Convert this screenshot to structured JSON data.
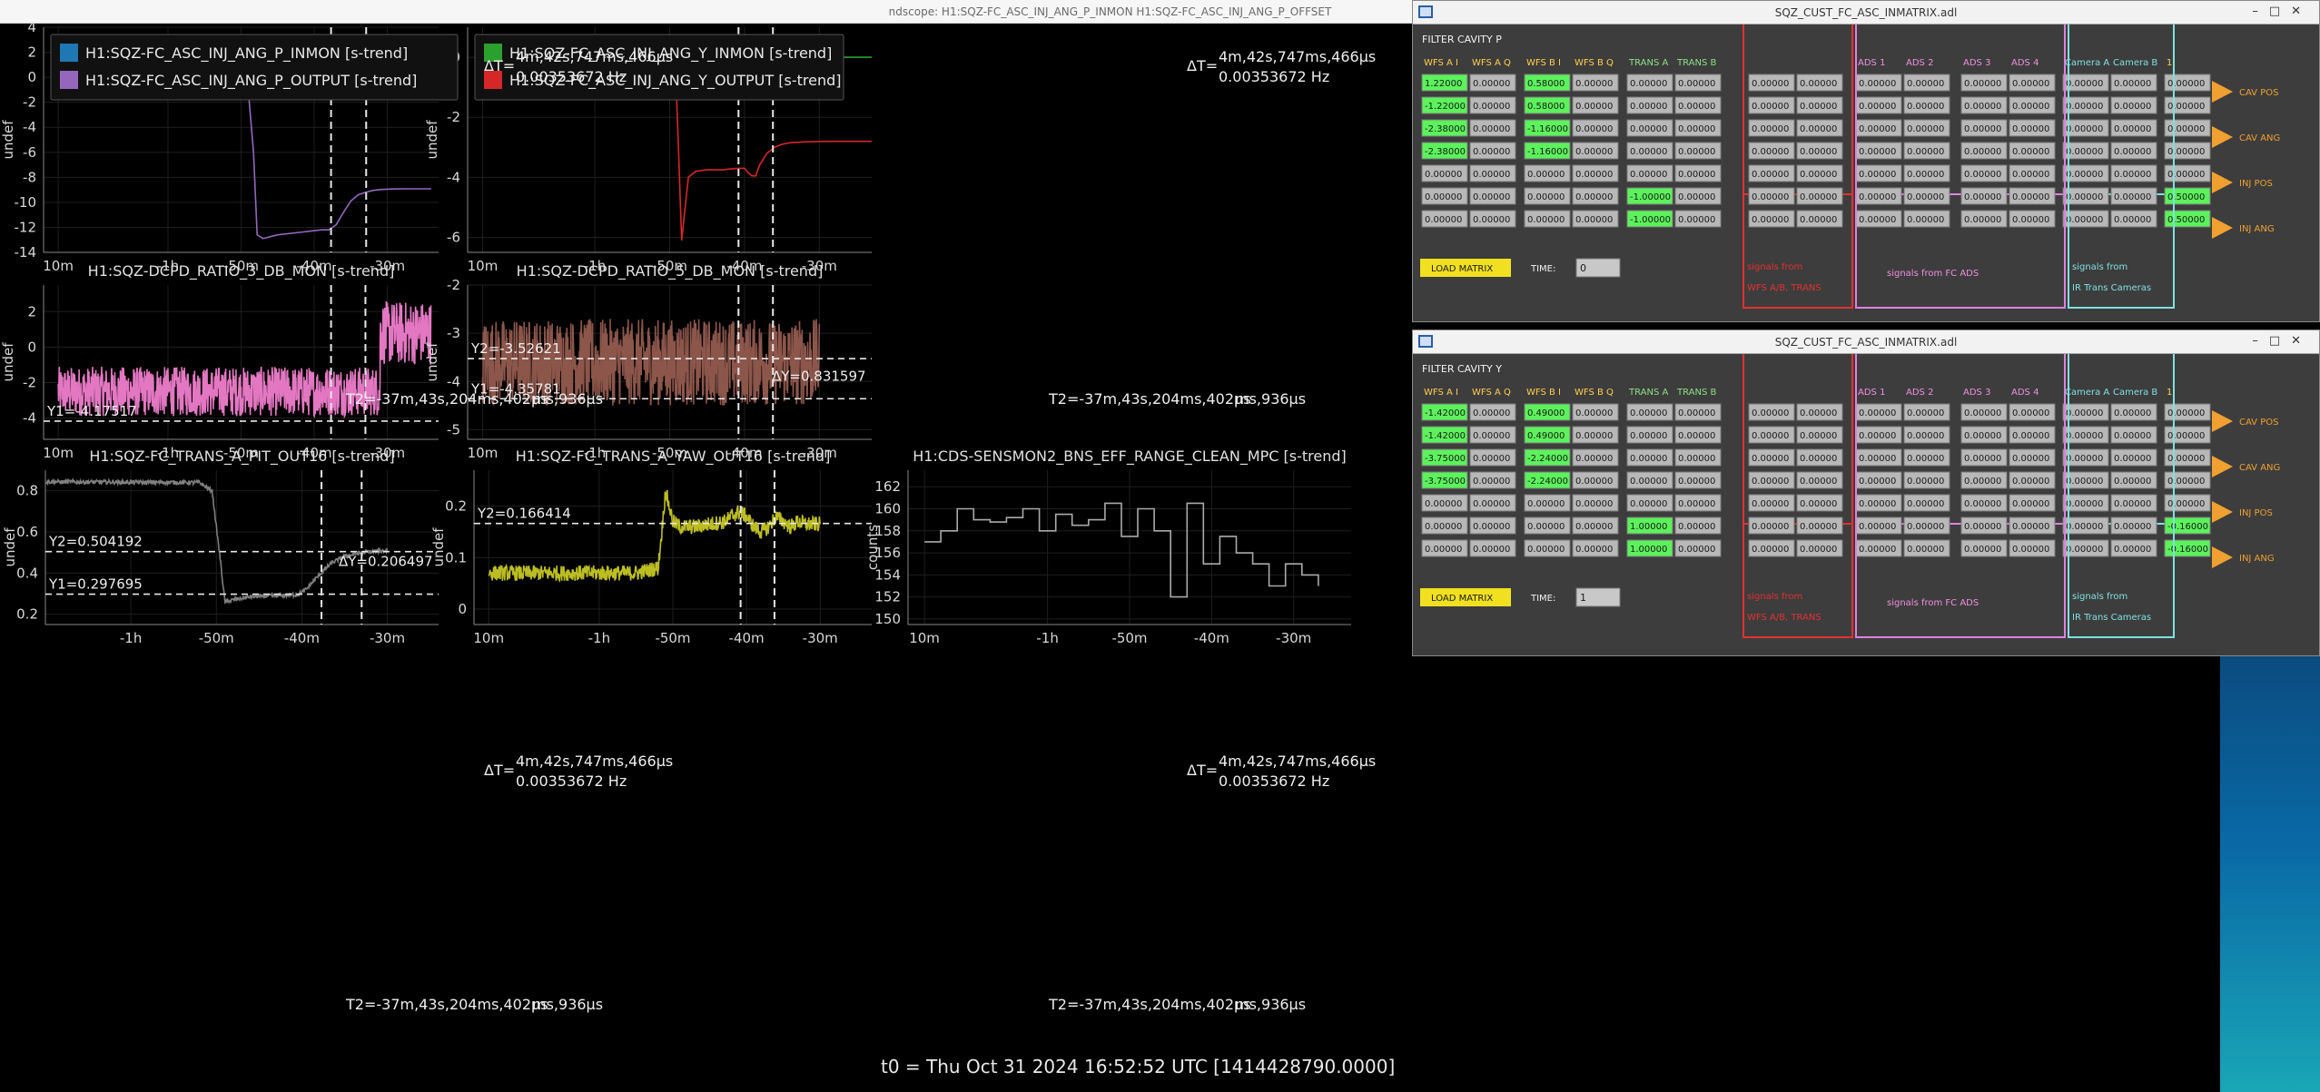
{
  "window": {
    "title": "ndscope: H1:SQZ-FC_ASC_INJ_ANG_P_INMON H1:SQZ-FC_ASC_INJ_ANG_P_OFFSET"
  },
  "footer": {
    "t0": "t0 = Thu Oct 31 2024 16:52:52 UTC [1414428790.0000]"
  },
  "colors": {
    "blue": "#1f77b4",
    "purple": "#9467bd",
    "green": "#2ca02c",
    "red": "#d62728",
    "pink": "#e377c2",
    "brown": "#8c564b",
    "gray": "#7f7f7f",
    "olive": "#bcbd22",
    "accent_orange": "#f0a030"
  },
  "cursors": {
    "delta_t": "ΔT=",
    "delta_t_value": "4m,42s,747ms,466μs",
    "delta_t_hz": "0.00353672 Hz",
    "t2": "T2=-37m,43s,204ms,402μs",
    "t2_suffix": "ms,936μs"
  },
  "chart_data": [
    {
      "type": "line",
      "panel": "top-left",
      "title": "",
      "ylabel": "undef",
      "ylim": [
        -14,
        4
      ],
      "yticks": [
        "4",
        "2",
        "0",
        "-2",
        "-4",
        "-6",
        "-8",
        "-10",
        "-12",
        "-14"
      ],
      "xticks": [
        "10m",
        "-1h",
        "-50m",
        "-40m",
        "-30m"
      ],
      "legend": [
        {
          "name": "H1:SQZ-FC_ASC_INJ_ANG_P_INMON [s-trend]",
          "color": "#1f77b4"
        },
        {
          "name": "H1:SQZ-FC_ASC_INJ_ANG_P_OUTPUT [s-trend]",
          "color": "#9467bd"
        }
      ],
      "series": [
        {
          "name": "H1:SQZ-FC_ASC_INJ_ANG_P_INMON [s-trend]",
          "color": "#1f77b4",
          "x": [
            -75,
            -24
          ],
          "y": [
            0,
            0
          ]
        },
        {
          "name": "H1:SQZ-FC_ASC_INJ_ANG_P_OUTPUT [s-trend]",
          "color": "#9467bd",
          "x": [
            -75,
            -51,
            -49,
            -48.3,
            -47.8,
            -47,
            -45,
            -42,
            -39,
            -38,
            -37,
            -36,
            -35,
            -34,
            -33,
            -32,
            -31,
            -30,
            -29,
            -27,
            -24
          ],
          "y": [
            0,
            0,
            -1.2,
            -6,
            -12.6,
            -12.9,
            -12.6,
            -12.4,
            -12.2,
            -12.2,
            -11.8,
            -10.8,
            -9.9,
            -9.4,
            -9.2,
            -9.05,
            -8.98,
            -8.95,
            -8.93,
            -8.92,
            -8.92
          ]
        }
      ]
    },
    {
      "type": "line",
      "panel": "top-middle",
      "title": "",
      "ylabel": "undef",
      "ylim": [
        -6.5,
        1
      ],
      "yticks": [
        "0",
        "-2",
        "-4",
        "-6"
      ],
      "xticks": [
        "10m",
        "-1h",
        "-50m",
        "-40m",
        "-30m"
      ],
      "legend": [
        {
          "name": "H1:SQZ-FC_ASC_INJ_ANG_Y_INMON [s-trend]",
          "color": "#2ca02c"
        },
        {
          "name": "H1:SQZ-FC_ASC_INJ_ANG_Y_OUTPUT [s-trend]",
          "color": "#d62728"
        }
      ],
      "series": [
        {
          "name": "H1:SQZ-FC_ASC_INJ_ANG_Y_INMON [s-trend]",
          "color": "#2ca02c",
          "x": [
            -51,
            -18
          ],
          "y": [
            0,
            0
          ]
        },
        {
          "name": "H1:SQZ-FC_ASC_INJ_ANG_Y_OUTPUT [s-trend]",
          "color": "#d62728",
          "x": [
            -75,
            -51.5,
            -49.2,
            -48.8,
            -48.4,
            -47.5,
            -46.5,
            -45,
            -43,
            -41,
            -40,
            -39.5,
            -39,
            -38.5,
            -38,
            -37,
            -36,
            -35,
            -34,
            -32,
            -29,
            -25,
            -18
          ],
          "y": [
            0,
            0,
            -0.5,
            -3.2,
            -6.1,
            -4.0,
            -3.8,
            -3.75,
            -3.75,
            -3.7,
            -3.7,
            -3.85,
            -3.95,
            -3.95,
            -3.6,
            -3.2,
            -3.0,
            -2.9,
            -2.85,
            -2.82,
            -2.8,
            -2.8,
            -2.8
          ]
        }
      ]
    },
    {
      "type": "line",
      "panel": "mid-left",
      "title": "H1:SQZ-DCPD_RATIO_3_DB_MON [s-trend]",
      "ylabel": "undef",
      "ylim": [
        -5.2,
        3.5
      ],
      "yticks": [
        "2",
        "0",
        "-2",
        "-4"
      ],
      "xticks": [
        "10m",
        "-1h",
        "-50m",
        "-40m",
        "-30m"
      ],
      "series": [
        {
          "name": "H1:SQZ-DCPD_RATIO_3_DB_MON [s-trend]",
          "color": "#e377c2",
          "segments": [
            [
              -75,
              -31,
              -2.5,
              1.4
            ],
            [
              -31,
              -24,
              0.8,
              1.8
            ]
          ]
        }
      ],
      "cursor_y": [
        {
          "label": "Y1=-4.17517",
          "value": -4.17517
        }
      ]
    },
    {
      "type": "line",
      "panel": "mid-middle",
      "title": "H1:SQZ-DCPD_RATIO_5_DB_MON [s-trend]",
      "ylabel": "undef",
      "ylim": [
        -5.2,
        -2
      ],
      "yticks": [
        "-2",
        "-3",
        "-4",
        "-5"
      ],
      "xticks": [
        "10m",
        "-1h",
        "-50m",
        "-40m",
        "-30m"
      ],
      "series": [
        {
          "name": "H1:SQZ-DCPD_RATIO_5_DB_MON [s-trend]",
          "color": "#8c564b",
          "segments": [
            [
              -75,
              -30,
              -3.6,
              0.9
            ]
          ]
        }
      ],
      "cursor_y": [
        {
          "label": "Y2=-3.52621",
          "value": -3.52621
        },
        {
          "label": "Y1=-4.35781",
          "value": -4.35781
        }
      ],
      "delta_y": "ΔY=0.831597"
    },
    {
      "type": "line",
      "panel": "bottom-left",
      "title": "H1:SQZ-FC_TRANS_A_PIT_OUT16 [s-trend]",
      "ylabel": "undef",
      "ylim": [
        0.15,
        0.9
      ],
      "yticks": [
        "0.8",
        "0.6",
        "0.4",
        "0.2"
      ],
      "xticks": [
        "-1h",
        "-50m",
        "-40m",
        "-30m"
      ],
      "series": [
        {
          "name": "H1:SQZ-FC_TRANS_A_PIT_OUT16 [s-trend]",
          "color": "#7f7f7f",
          "x": [
            -75,
            -52,
            -50.5,
            -49.5,
            -49,
            -48,
            -46,
            -43,
            -40.5,
            -39.5,
            -38,
            -36.5,
            -35,
            -33,
            -31.5,
            -30
          ],
          "y": [
            0.845,
            0.84,
            0.8,
            0.45,
            0.26,
            0.27,
            0.285,
            0.29,
            0.295,
            0.32,
            0.39,
            0.45,
            0.48,
            0.5,
            0.505,
            0.51
          ]
        }
      ],
      "cursor_y": [
        {
          "label": "Y2=0.504192",
          "value": 0.504192
        },
        {
          "label": "Y1=0.297695",
          "value": 0.297695
        }
      ],
      "delta_y": "ΔY=0.206497"
    },
    {
      "type": "line",
      "panel": "bottom-middle",
      "title": "H1:SQZ-FC_TRANS_A_YAW_OUT16 [s-trend]",
      "ylabel": "undef",
      "ylim": [
        -0.03,
        0.27
      ],
      "yticks": [
        "0.2",
        "0.1",
        "0"
      ],
      "xticks": [
        "10m",
        "-1h",
        "-50m",
        "-40m",
        "-30m"
      ],
      "series": [
        {
          "name": "H1:SQZ-FC_TRANS_A_YAW_OUT16 [s-trend]",
          "color": "#bcbd22",
          "x": [
            -75,
            -55,
            -52,
            -51.5,
            -51,
            -50.5,
            -50,
            -49,
            -47,
            -45,
            -43,
            -42,
            -41,
            -40,
            -39,
            -38,
            -37,
            -36,
            -35,
            -34,
            -33,
            -32,
            -31,
            -30
          ],
          "y": [
            0.07,
            0.07,
            0.08,
            0.15,
            0.23,
            0.2,
            0.17,
            0.16,
            0.16,
            0.165,
            0.17,
            0.18,
            0.19,
            0.18,
            0.16,
            0.15,
            0.16,
            0.18,
            0.17,
            0.16,
            0.17,
            0.165,
            0.165,
            0.165
          ]
        }
      ],
      "cursor_y": [
        {
          "label": "Y2=0.166414",
          "value": 0.166414
        }
      ]
    },
    {
      "type": "line",
      "panel": "bottom-right",
      "title": "H1:CDS-SENSMON2_BNS_EFF_RANGE_CLEAN_MPC [s-trend]",
      "ylabel": "counts",
      "ylim": [
        149.5,
        163.5
      ],
      "yticks": [
        "162",
        "160",
        "158",
        "156",
        "154",
        "152",
        "150"
      ],
      "xticks": [
        "10m",
        "-1h",
        "-50m",
        "-40m",
        "-30m"
      ],
      "series": [
        {
          "name": "H1:CDS-SENSMON2_BNS_EFF_RANGE_CLEAN_MPC [s-trend]",
          "color": "#aaaaaa",
          "x": [
            -75,
            -73,
            -71,
            -69,
            -67,
            -65,
            -63,
            -61,
            -59,
            -57,
            -55,
            -53,
            -51,
            -49,
            -47,
            -45,
            -43,
            -41,
            -39,
            -37,
            -35,
            -33,
            -31,
            -29,
            -27
          ],
          "y": [
            157,
            158,
            160,
            159,
            158.8,
            159.2,
            160,
            158,
            159.5,
            158.5,
            159,
            160.5,
            157.5,
            160,
            158,
            152,
            160.5,
            155,
            157.5,
            156,
            155,
            153,
            155,
            154,
            153
          ]
        }
      ]
    }
  ],
  "matrix_p": {
    "title": "SQZ_CUST_FC_ASC_INMATRIX.adl",
    "header": "FILTER CAVITY P",
    "cols": [
      "WFS A I",
      "WFS A Q",
      "WFS B I",
      "WFS B Q",
      "TRANS A",
      "TRANS B",
      "",
      "",
      "ADS 1",
      "ADS 2",
      "ADS 3",
      "ADS 4",
      "Camera A",
      "Camera B",
      "1"
    ],
    "rows": [
      [
        "1.22000",
        "0.00000",
        "0.58000",
        "0.00000",
        "0.00000",
        "0.00000",
        "0.00000",
        "0.00000",
        "0.00000",
        "0.00000",
        "0.00000",
        "0.00000",
        "0.00000",
        "0.00000",
        "0.00000"
      ],
      [
        "-1.22000",
        "0.00000",
        "0.58000",
        "0.00000",
        "0.00000",
        "0.00000",
        "0.00000",
        "0.00000",
        "0.00000",
        "0.00000",
        "0.00000",
        "0.00000",
        "0.00000",
        "0.00000",
        "0.00000"
      ],
      [
        "-2.38000",
        "0.00000",
        "-1.16000",
        "0.00000",
        "0.00000",
        "0.00000",
        "0.00000",
        "0.00000",
        "0.00000",
        "0.00000",
        "0.00000",
        "0.00000",
        "0.00000",
        "0.00000",
        "0.00000"
      ],
      [
        "-2.38000",
        "0.00000",
        "-1.16000",
        "0.00000",
        "0.00000",
        "0.00000",
        "0.00000",
        "0.00000",
        "0.00000",
        "0.00000",
        "0.00000",
        "0.00000",
        "0.00000",
        "0.00000",
        "0.00000"
      ],
      [
        "0.00000",
        "0.00000",
        "0.00000",
        "0.00000",
        "0.00000",
        "0.00000",
        "0.00000",
        "0.00000",
        "0.00000",
        "0.00000",
        "0.00000",
        "0.00000",
        "0.00000",
        "0.00000",
        "0.00000"
      ],
      [
        "0.00000",
        "0.00000",
        "0.00000",
        "0.00000",
        "-1.00000",
        "0.00000",
        "0.00000",
        "0.00000",
        "0.00000",
        "0.00000",
        "0.00000",
        "0.00000",
        "0.00000",
        "0.00000",
        "0.50000"
      ],
      [
        "0.00000",
        "0.00000",
        "0.00000",
        "0.00000",
        "-1.00000",
        "0.00000",
        "0.00000",
        "0.00000",
        "0.00000",
        "0.00000",
        "0.00000",
        "0.00000",
        "0.00000",
        "0.00000",
        "0.50000"
      ]
    ],
    "load": "LOAD MATRIX",
    "time_label": "TIME:",
    "time_value": "0",
    "box_red": [
      "signals from",
      "WFS A/B, TRANS"
    ],
    "box_pink": "signals from FC ADS",
    "box_cyan": [
      "signals from",
      "IR Trans Cameras"
    ],
    "outputs": [
      "CAV POS",
      "CAV ANG",
      "INJ POS",
      "INJ ANG"
    ]
  },
  "matrix_y": {
    "title": "SQZ_CUST_FC_ASC_INMATRIX.adl",
    "header": "FILTER CAVITY Y",
    "rows": [
      [
        "-1.42000",
        "0.00000",
        "0.49000",
        "0.00000",
        "0.00000",
        "0.00000",
        "0.00000",
        "0.00000",
        "0.00000",
        "0.00000",
        "0.00000",
        "0.00000",
        "0.00000",
        "0.00000",
        "0.00000"
      ],
      [
        "-1.42000",
        "0.00000",
        "0.49000",
        "0.00000",
        "0.00000",
        "0.00000",
        "0.00000",
        "0.00000",
        "0.00000",
        "0.00000",
        "0.00000",
        "0.00000",
        "0.00000",
        "0.00000",
        "0.00000"
      ],
      [
        "-3.75000",
        "0.00000",
        "-2.24000",
        "0.00000",
        "0.00000",
        "0.00000",
        "0.00000",
        "0.00000",
        "0.00000",
        "0.00000",
        "0.00000",
        "0.00000",
        "0.00000",
        "0.00000",
        "0.00000"
      ],
      [
        "-3.75000",
        "0.00000",
        "-2.24000",
        "0.00000",
        "0.00000",
        "0.00000",
        "0.00000",
        "0.00000",
        "0.00000",
        "0.00000",
        "0.00000",
        "0.00000",
        "0.00000",
        "0.00000",
        "0.00000"
      ],
      [
        "0.00000",
        "0.00000",
        "0.00000",
        "0.00000",
        "0.00000",
        "0.00000",
        "0.00000",
        "0.00000",
        "0.00000",
        "0.00000",
        "0.00000",
        "0.00000",
        "0.00000",
        "0.00000",
        "0.00000"
      ],
      [
        "0.00000",
        "0.00000",
        "0.00000",
        "0.00000",
        "1.00000",
        "0.00000",
        "0.00000",
        "0.00000",
        "0.00000",
        "0.00000",
        "0.00000",
        "0.00000",
        "0.00000",
        "0.00000",
        "-0.16000"
      ],
      [
        "0.00000",
        "0.00000",
        "0.00000",
        "0.00000",
        "1.00000",
        "0.00000",
        "0.00000",
        "0.00000",
        "0.00000",
        "0.00000",
        "0.00000",
        "0.00000",
        "0.00000",
        "0.00000",
        "-0.16000"
      ]
    ],
    "time_value": "1"
  }
}
